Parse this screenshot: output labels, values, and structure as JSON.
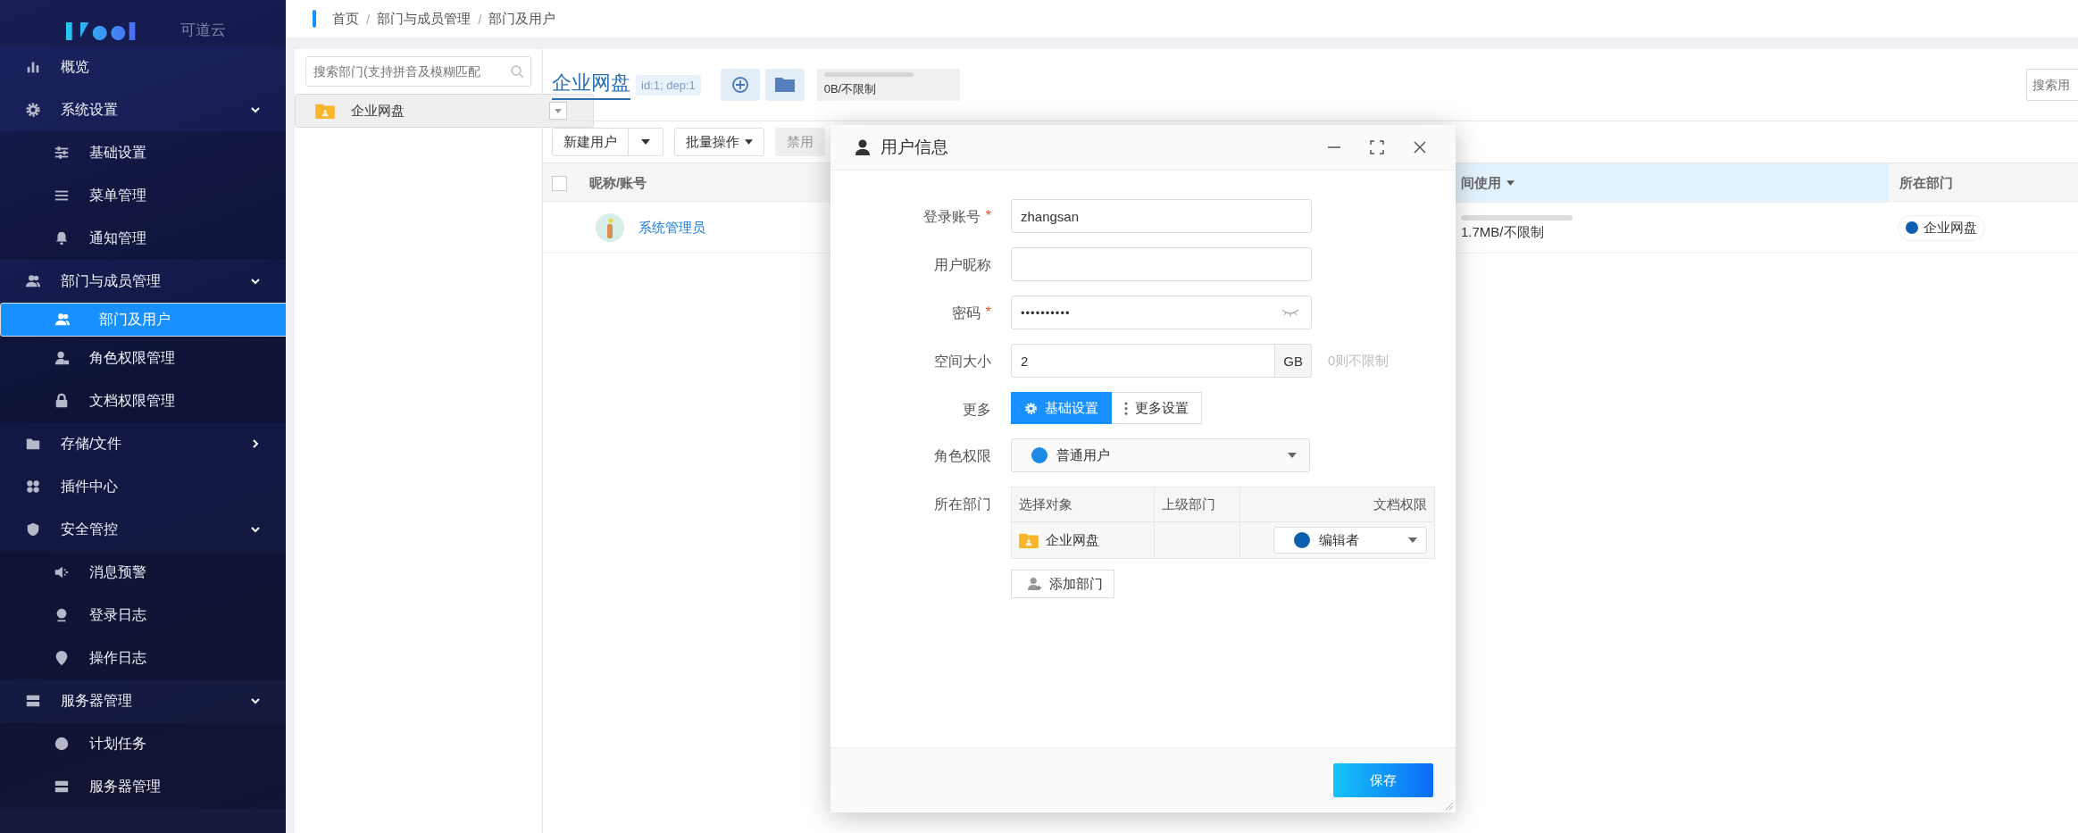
{
  "sidebar": {
    "brand": "可道云",
    "menu": [
      {
        "label": "概览",
        "selected": false
      },
      {
        "label": "系统设置",
        "selected": false,
        "expanded": true,
        "children": [
          {
            "label": "基础设置",
            "selected": false
          },
          {
            "label": "菜单管理",
            "selected": false
          },
          {
            "label": "通知管理",
            "selected": false
          }
        ]
      },
      {
        "label": "部门与成员管理",
        "selected": false,
        "expanded": true,
        "children": [
          {
            "label": "部门及用户",
            "selected": true
          },
          {
            "label": "角色权限管理",
            "selected": false
          },
          {
            "label": "文档权限管理",
            "selected": false
          }
        ]
      },
      {
        "label": "存储/文件",
        "selected": false,
        "expanded": false
      },
      {
        "label": "插件中心",
        "selected": false
      },
      {
        "label": "安全管控",
        "selected": false,
        "expanded": true,
        "children": [
          {
            "label": "消息预警",
            "selected": false
          },
          {
            "label": "登录日志",
            "selected": false
          },
          {
            "label": "操作日志",
            "selected": false
          }
        ]
      },
      {
        "label": "服务器管理",
        "selected": false,
        "expanded": true,
        "children": [
          {
            "label": "计划任务",
            "selected": false
          },
          {
            "label": "服务器管理",
            "selected": false
          }
        ]
      }
    ]
  },
  "breadcrumb": [
    "首页",
    "部门与成员管理",
    "部门及用户"
  ],
  "breadcrumb_separator": "/",
  "dept_panel": {
    "search": {
      "placeholder": "搜索部门(支持拼音及模糊匹配"
    },
    "tree": [
      {
        "label": "企业网盘",
        "selected": true
      }
    ]
  },
  "header": {
    "title": "企业网盘",
    "tag": "id:1; dep:1",
    "storage": {
      "level": 0,
      "reading": "0B/不限制"
    },
    "search": {
      "placeholder": "搜索用"
    }
  },
  "toolbar": [
    {
      "label": "新建用户",
      "kind": "split"
    },
    {
      "label": "批量操作",
      "kind": "dropdown"
    },
    {
      "label": "禁用",
      "kind": "disabled"
    }
  ],
  "table": {
    "select_all": {
      "checked": false
    },
    "columns": [
      {
        "label": "昵称/账号",
        "selected": false
      },
      {
        "label": "间使用",
        "selected": true
      },
      {
        "label": "所在部门",
        "selected": false
      }
    ],
    "rows": [
      {
        "name": "系统管理员",
        "usage": {
          "level": 0
        },
        "usage_text": "1.7MB/不限制",
        "dept": "企业网盘",
        "color": "#0f5fb0"
      }
    ]
  },
  "dialog": {
    "title": "用户信息",
    "fields": [
      {
        "kind": "text",
        "label": "登录账号",
        "required": true,
        "value": "zhangsan"
      },
      {
        "kind": "text",
        "label": "用户昵称",
        "required": false
      },
      {
        "kind": "password",
        "label": "密码",
        "required": true,
        "value": "••••••••••"
      },
      {
        "kind": "unit",
        "label": "空间大小",
        "value": "2",
        "unit": "GB",
        "hint": "0则不限制"
      },
      {
        "kind": "segmented",
        "label": "更多",
        "options": [
          {
            "label": "基础设置",
            "selected": true
          },
          {
            "label": "更多设置",
            "selected": false
          }
        ]
      },
      {
        "kind": "select",
        "label": "角色权限",
        "value": "普通用户",
        "color": "#1a8ae6"
      },
      {
        "kind": "depts",
        "label": "所在部门",
        "columns": [
          "选择对象",
          "上级部门",
          "文档权限"
        ],
        "rows": [
          {
            "name": "企业网盘",
            "permission": "编辑者",
            "color": "#0f5fb0"
          }
        ],
        "add_button": "添加部门"
      }
    ],
    "required_mark": "*",
    "save_button": "保存"
  }
}
